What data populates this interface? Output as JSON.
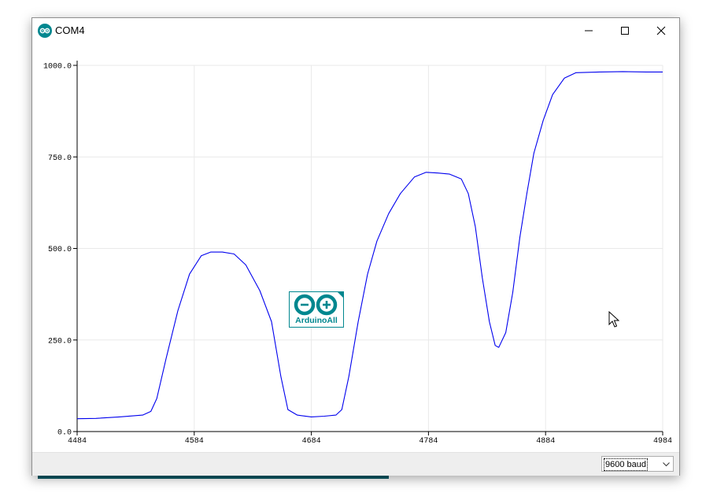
{
  "window": {
    "title": "COM4",
    "buttons": {
      "minimize": "minimize",
      "maximize": "maximize",
      "close": "close"
    }
  },
  "icons": {
    "app": "arduino-infinity-icon",
    "minimize": "minimize-icon",
    "maximize": "maximize-icon",
    "close": "close-icon",
    "dropdown": "chevron-down-icon",
    "cursor": "mouse-pointer-icon"
  },
  "watermark": {
    "text": "ArduinoAll"
  },
  "statusbar": {
    "baud_rate": {
      "selected": "9600 baud"
    }
  },
  "colors": {
    "series": "#0000ee",
    "accent": "#00878f",
    "grid": "#e9e9e9"
  },
  "chart_data": {
    "type": "line",
    "xlim": [
      4484,
      4984
    ],
    "ylim": [
      0,
      1000
    ],
    "x_ticks": [
      "4484",
      "4584",
      "4684",
      "4784",
      "4884",
      "4984"
    ],
    "y_ticks": [
      "0.0",
      "250.0",
      "500.0",
      "750.0",
      "1000.0"
    ],
    "grid": true,
    "series": [
      {
        "points": [
          [
            4484,
            35
          ],
          [
            4500,
            36
          ],
          [
            4520,
            40
          ],
          [
            4540,
            45
          ],
          [
            4547,
            55
          ],
          [
            4552,
            90
          ],
          [
            4560,
            200
          ],
          [
            4570,
            330
          ],
          [
            4580,
            430
          ],
          [
            4590,
            480
          ],
          [
            4598,
            490
          ],
          [
            4608,
            490
          ],
          [
            4618,
            485
          ],
          [
            4628,
            455
          ],
          [
            4640,
            385
          ],
          [
            4650,
            300
          ],
          [
            4658,
            150
          ],
          [
            4664,
            60
          ],
          [
            4672,
            45
          ],
          [
            4684,
            40
          ],
          [
            4695,
            42
          ],
          [
            4705,
            45
          ],
          [
            4710,
            60
          ],
          [
            4716,
            150
          ],
          [
            4724,
            300
          ],
          [
            4732,
            430
          ],
          [
            4740,
            520
          ],
          [
            4750,
            595
          ],
          [
            4760,
            650
          ],
          [
            4772,
            695
          ],
          [
            4782,
            708
          ],
          [
            4792,
            706
          ],
          [
            4802,
            703
          ],
          [
            4812,
            690
          ],
          [
            4818,
            650
          ],
          [
            4824,
            560
          ],
          [
            4830,
            420
          ],
          [
            4836,
            300
          ],
          [
            4841,
            235
          ],
          [
            4844,
            230
          ],
          [
            4850,
            270
          ],
          [
            4856,
            380
          ],
          [
            4862,
            530
          ],
          [
            4868,
            650
          ],
          [
            4874,
            760
          ],
          [
            4882,
            850
          ],
          [
            4890,
            920
          ],
          [
            4900,
            965
          ],
          [
            4910,
            980
          ],
          [
            4930,
            982
          ],
          [
            4950,
            983
          ],
          [
            4970,
            982
          ],
          [
            4984,
            982
          ]
        ]
      }
    ]
  }
}
